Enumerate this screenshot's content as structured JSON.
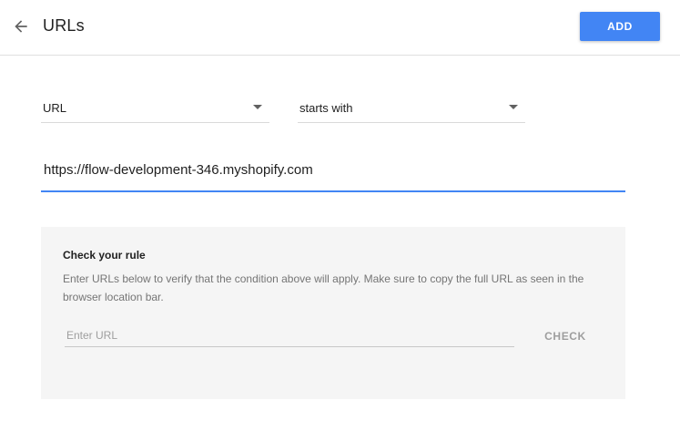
{
  "header": {
    "title": "URLs",
    "back_icon": "arrow-left-icon",
    "add_label": "ADD",
    "accent_color": "#4285f4"
  },
  "rule": {
    "field": "URL",
    "operator": "starts with",
    "value": "https://flow-development-346.myshopify.com"
  },
  "check": {
    "title": "Check your rule",
    "description": "Enter URLs below to verify that the condition above will apply. Make sure to copy the full URL as seen in the browser location bar.",
    "placeholder": "Enter URL",
    "button_label": "CHECK"
  }
}
